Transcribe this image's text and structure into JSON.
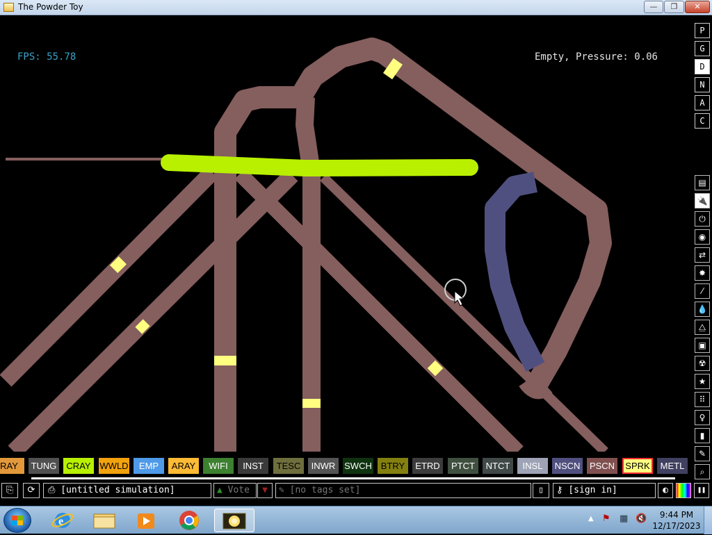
{
  "window": {
    "title": "The Powder Toy",
    "min": "—",
    "max": "❐",
    "close": "✕"
  },
  "hud": {
    "fps": "FPS: 55.78",
    "status": "Empty, Pressure: 0.06"
  },
  "side_buttons": [
    "P",
    "G",
    "D",
    "N",
    "A",
    "C"
  ],
  "side_active": "D",
  "categories": [
    {
      "name": "walls-icon",
      "glyph": "▤"
    },
    {
      "name": "electronics-icon",
      "glyph": "🔌"
    },
    {
      "name": "powered-icon",
      "glyph": "⏻"
    },
    {
      "name": "sensors-icon",
      "glyph": "◉"
    },
    {
      "name": "force-icon",
      "glyph": "⇄"
    },
    {
      "name": "explosives-icon",
      "glyph": "✸"
    },
    {
      "name": "gases-icon",
      "glyph": "⁄"
    },
    {
      "name": "liquids-icon",
      "glyph": "💧"
    },
    {
      "name": "powders-icon",
      "glyph": "⧋"
    },
    {
      "name": "solids-icon",
      "glyph": "▣"
    },
    {
      "name": "radioactive-icon",
      "glyph": "☢"
    },
    {
      "name": "special-icon",
      "glyph": "★"
    },
    {
      "name": "life-icon",
      "glyph": "⠿"
    },
    {
      "name": "tools-icon",
      "glyph": "♀"
    },
    {
      "name": "bookmark-icon",
      "glyph": "▮"
    },
    {
      "name": "decoration-icon",
      "glyph": "✎"
    },
    {
      "name": "search-icon",
      "glyph": "⌕"
    }
  ],
  "elements": [
    {
      "label": "RAY",
      "bg": "#e2983b",
      "fg": "#000000"
    },
    {
      "label": "TUNG",
      "bg": "#505050",
      "fg": "#ffffff"
    },
    {
      "label": "CRAY",
      "bg": "#b8f000",
      "fg": "#000000"
    },
    {
      "label": "WWLD",
      "bg": "#f2a20d",
      "fg": "#000000"
    },
    {
      "label": "EMP",
      "bg": "#4f9ae8",
      "fg": "#ffffff"
    },
    {
      "label": "ARAY",
      "bg": "#ffbb33",
      "fg": "#000000"
    },
    {
      "label": "WIFI",
      "bg": "#3c8030",
      "fg": "#ffffff"
    },
    {
      "label": "INST",
      "bg": "#3a3a3a",
      "fg": "#ffffff"
    },
    {
      "label": "TESC",
      "bg": "#6f6f3e",
      "fg": "#000000"
    },
    {
      "label": "INWR",
      "bg": "#545454",
      "fg": "#ffffff"
    },
    {
      "label": "SWCH",
      "bg": "#0f330f",
      "fg": "#ffffff"
    },
    {
      "label": "BTRY",
      "bg": "#848010",
      "fg": "#000000"
    },
    {
      "label": "ETRD",
      "bg": "#3c3c3c",
      "fg": "#ffffff"
    },
    {
      "label": "PTCT",
      "bg": "#405040",
      "fg": "#ffffff"
    },
    {
      "label": "NTCT",
      "bg": "#404848",
      "fg": "#ffffff"
    },
    {
      "label": "INSL",
      "bg": "#9ea3b6",
      "fg": "#ffffff"
    },
    {
      "label": "NSCN",
      "bg": "#505080",
      "fg": "#ffffff"
    },
    {
      "label": "PSCN",
      "bg": "#805050",
      "fg": "#ffffff"
    },
    {
      "label": "SPRK",
      "bg": "#ffff80",
      "fg": "#000000",
      "selected": true
    },
    {
      "label": "METL",
      "bg": "#404060",
      "fg": "#ffffff"
    }
  ],
  "bottom": {
    "open_icon": "⎘",
    "reload_icon": "⟳",
    "save_title": "[untitled simulation]",
    "vote_label": "Vote",
    "vote_up": "▲",
    "vote_down": "▼",
    "tags": "[no tags set]",
    "signin": "[sign in]",
    "pause": "❚❚"
  },
  "tray": {
    "time": "9:44 PM",
    "date": "12/17/2023"
  },
  "colors": {
    "wire": "#855e5e",
    "cray": "#b8f000",
    "spark": "#ffff80",
    "nscn": "#505080",
    "fps": "#3aa3c9"
  }
}
